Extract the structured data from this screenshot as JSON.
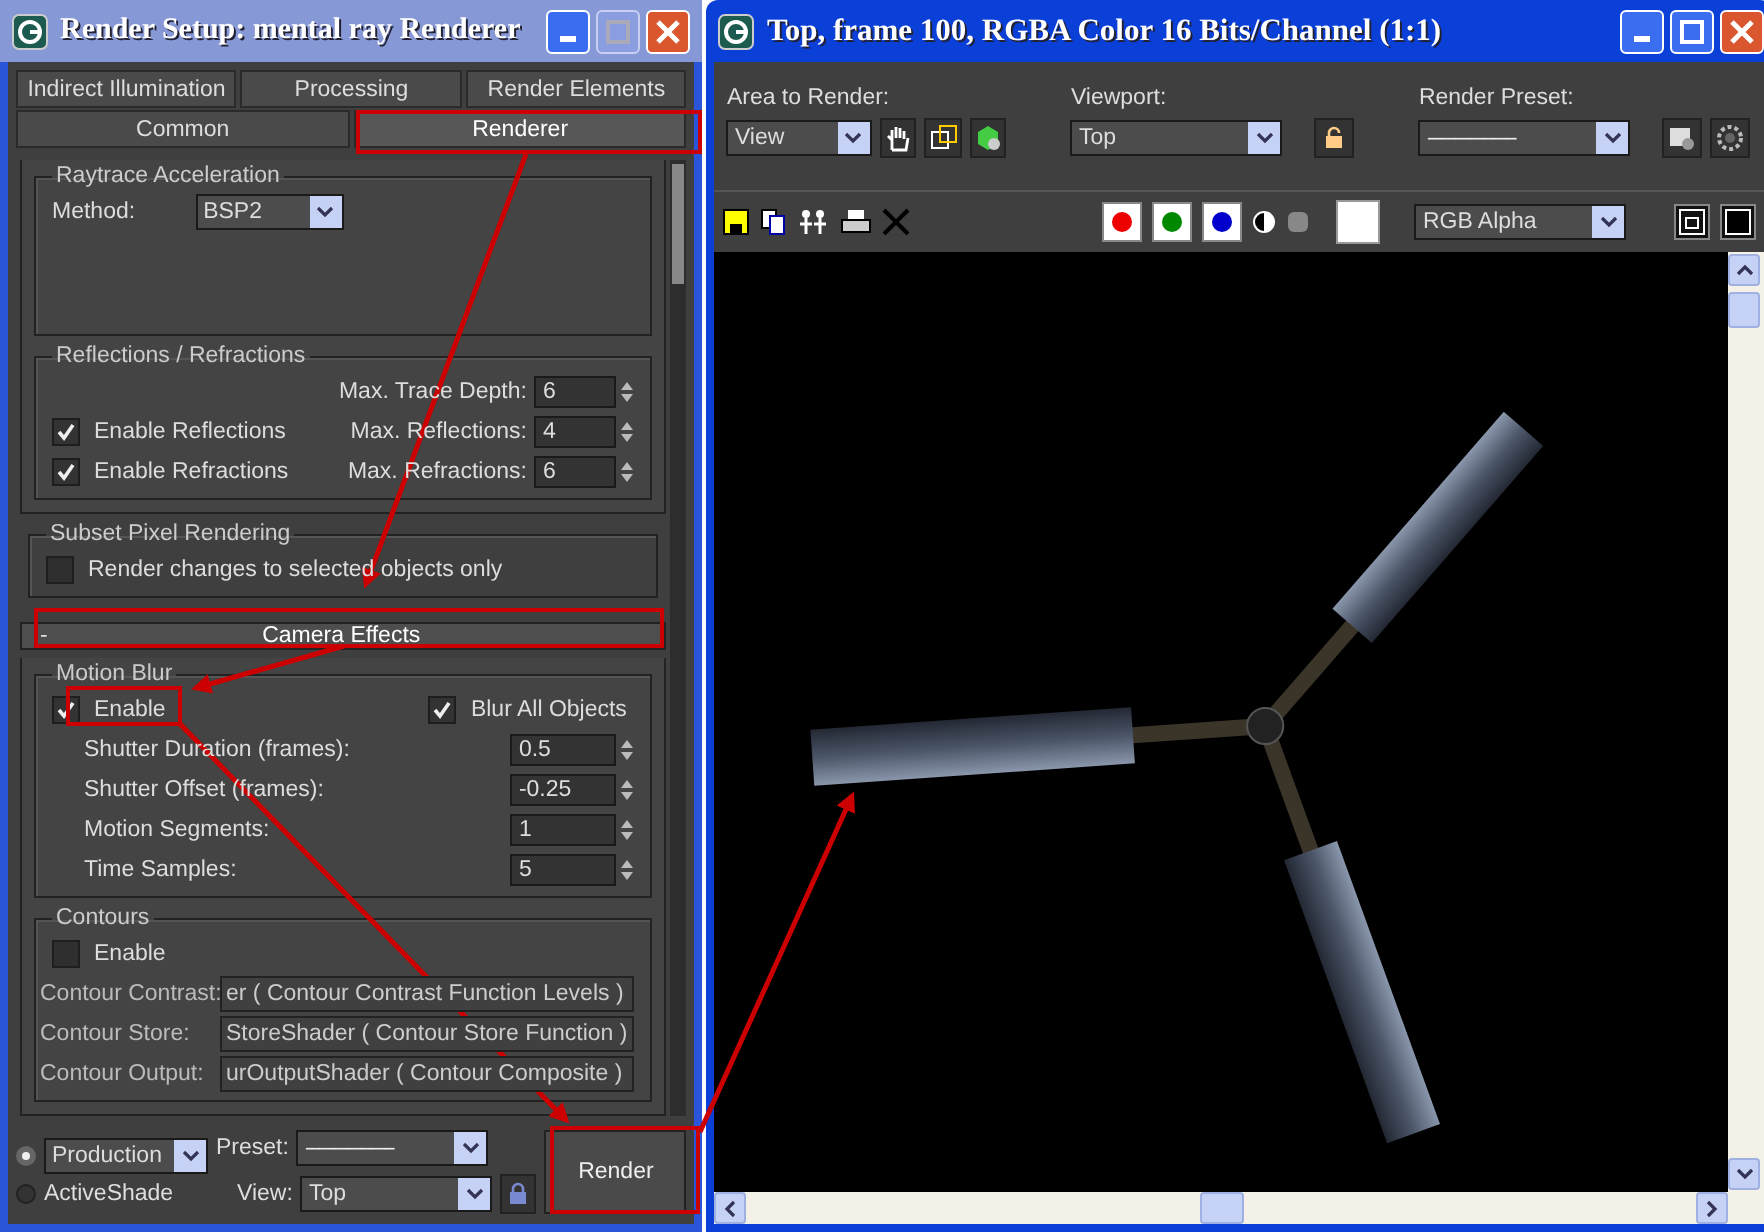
{
  "render_setup": {
    "title": "Render Setup: mental ray Renderer",
    "tabs_row1": [
      {
        "label": "Indirect Illumination",
        "selected": false
      },
      {
        "label": "Processing",
        "selected": false
      },
      {
        "label": "Render Elements",
        "selected": false
      }
    ],
    "tabs_row2": [
      {
        "label": "Common",
        "selected": false
      },
      {
        "label": "Renderer",
        "selected": true
      }
    ],
    "raytrace": {
      "title": "Raytrace Acceleration",
      "method_label": "Method:",
      "method": "BSP2"
    },
    "reflections": {
      "title": "Reflections / Refractions",
      "trace_depth_label": "Max. Trace Depth:",
      "trace_depth": "6",
      "options": [
        {
          "label": "Enable Reflections",
          "checked": true,
          "spin_label": "Max. Reflections:",
          "value": "4"
        },
        {
          "label": "Enable Refractions",
          "checked": true,
          "spin_label": "Max. Refractions:",
          "value": "6"
        }
      ]
    },
    "subset": {
      "title": "Subset Pixel Rendering",
      "label": "Render changes to selected objects only",
      "checked": false
    },
    "rollout": {
      "sign": "-",
      "title": "Camera Effects",
      "expanded": true
    },
    "motion_blur": {
      "title": "Motion Blur",
      "enable": {
        "label": "Enable",
        "checked": true
      },
      "blur_all": {
        "label": "Blur All Objects",
        "checked": true
      },
      "params": [
        {
          "label": "Shutter Duration (frames):",
          "value": "0.5"
        },
        {
          "label": "Shutter Offset (frames):",
          "value": "-0.25"
        },
        {
          "label": "Motion Segments:",
          "value": "1"
        },
        {
          "label": "Time Samples:",
          "value": "5"
        }
      ]
    },
    "contours": {
      "title": "Contours",
      "enable": {
        "label": "Enable",
        "checked": false
      },
      "shaders": [
        {
          "label": "Contour Contrast:",
          "value": "er  ( Contour Contrast Function Levels )"
        },
        {
          "label": "Contour Store:",
          "value": "StoreShader  ( Contour Store Function )"
        },
        {
          "label": "Contour Output:",
          "value": "urOutputShader  ( Contour Composite )"
        }
      ]
    },
    "footer": {
      "modes": [
        {
          "kind": "dropdown",
          "label": "Production",
          "selected": true
        },
        {
          "kind": "text",
          "label": "ActiveShade",
          "selected": false
        }
      ],
      "preset_label": "Preset:",
      "preset": "-------------------",
      "view_label": "View:",
      "view": "Top",
      "render_button": "Render"
    }
  },
  "frame_window": {
    "title": "Top, frame 100, RGBA Color 16 Bits/Channel (1:1)",
    "area_label": "Area to Render:",
    "area": "View",
    "viewport_label": "Viewport:",
    "viewport": "Top",
    "preset_label": "Render Preset:",
    "preset": "-------------------",
    "channel": "RGB Alpha"
  }
}
